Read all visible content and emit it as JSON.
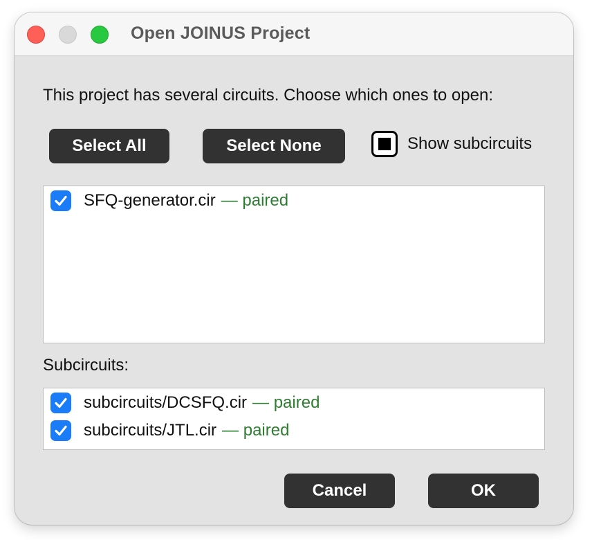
{
  "window": {
    "title": "Open JOINUS Project"
  },
  "dialog": {
    "prompt": "This project has several circuits. Choose which ones to open:",
    "select_all_label": "Select All",
    "select_none_label": "Select None",
    "show_subcircuits_label": "Show subcircuits",
    "show_subcircuits_state": "indeterminate",
    "circuits": [
      {
        "name": "SFQ-generator.cir",
        "status": "— paired",
        "checked": true
      }
    ],
    "subcircuits_heading": "Subcircuits:",
    "subcircuits": [
      {
        "name": "subcircuits/DCSFQ.cir",
        "status": "— paired",
        "checked": true
      },
      {
        "name": "subcircuits/JTL.cir",
        "status": "— paired",
        "checked": true
      }
    ],
    "cancel_label": "Cancel",
    "ok_label": "OK"
  },
  "colors": {
    "accent": "#1a7cf7",
    "paired_status": "#2e7d32",
    "button_dark": "#323232",
    "close": "#fe5f57",
    "minimize": "#d9d9d9",
    "zoom": "#28c840"
  },
  "icons": {
    "close": "close-icon",
    "minimize": "minimize-icon",
    "zoom": "zoom-icon",
    "checkbox": "checkmark-icon",
    "indeterminate": "indeterminate-square-icon"
  }
}
